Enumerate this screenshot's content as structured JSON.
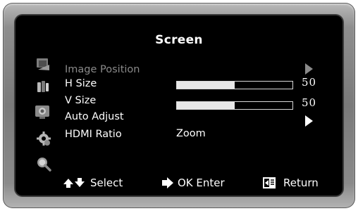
{
  "menu": {
    "title": "Screen"
  },
  "items": [
    {
      "label": "Image Position",
      "state": "disabled"
    },
    {
      "label": "H Size",
      "value": "50",
      "level": 0.5
    },
    {
      "label": "V Size",
      "value": "50",
      "level": 0.5
    },
    {
      "label": "Auto Adjust"
    },
    {
      "label": "HDMI Ratio",
      "value": "Zoom"
    }
  ],
  "side_icons": [
    "picture-icon",
    "color-icon",
    "screen-icon",
    "settings-gear-icon",
    "magnifier-icon"
  ],
  "footer": {
    "select": "Select",
    "enter": "OK Enter",
    "return": "Return"
  },
  "colors": {
    "background": "#000000",
    "text": "#ffffff",
    "disabled_text": "#8a8a8a",
    "bezel": "#8e8e8e"
  }
}
